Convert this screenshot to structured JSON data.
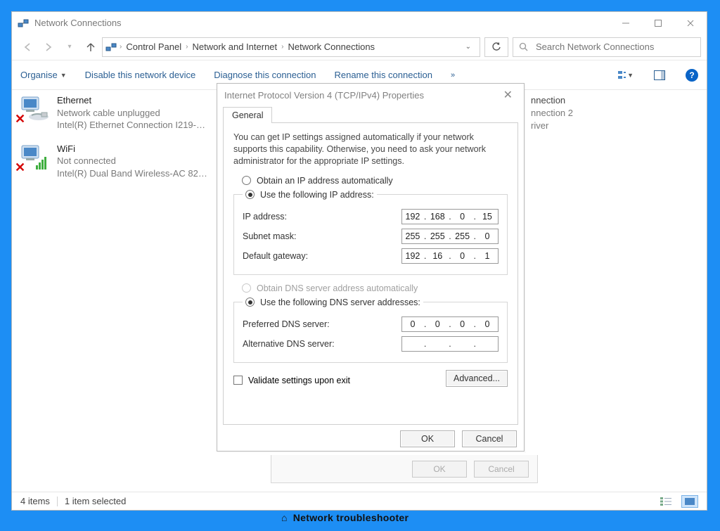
{
  "window": {
    "title": "Network Connections",
    "search_placeholder": "Search Network Connections"
  },
  "breadcrumb": [
    "Control Panel",
    "Network and Internet",
    "Network Connections"
  ],
  "cmdbar": {
    "organise": "Organise",
    "disable": "Disable this network device",
    "diagnose": "Diagnose this connection",
    "rename": "Rename this connection"
  },
  "connections": [
    {
      "name": "Ethernet",
      "status": "Network cable unplugged",
      "device": "Intel(R) Ethernet Connection I219-…",
      "error": true
    },
    {
      "name": "WiFi",
      "status": "Not connected",
      "device": "Intel(R) Dual Band Wireless-AC 82…",
      "error": true
    }
  ],
  "hidden_conn": {
    "l1": "nnection",
    "l2": "nnection 2",
    "l3": "river"
  },
  "statusbar": {
    "items": "4 items",
    "selected": "1 item selected"
  },
  "parent_dialog": {
    "ok": "OK",
    "cancel": "Cancel"
  },
  "dialog": {
    "title": "Internet Protocol Version 4 (TCP/IPv4) Properties",
    "tab": "General",
    "intro": "You can get IP settings assigned automatically if your network supports this capability. Otherwise, you need to ask your network administrator for the appropriate IP settings.",
    "radio_auto_ip": "Obtain an IP address automatically",
    "radio_static_ip": "Use the following IP address:",
    "radio_auto_dns": "Obtain DNS server address automatically",
    "radio_static_dns": "Use the following DNS server addresses:",
    "labels": {
      "ip": "IP address:",
      "mask": "Subnet mask:",
      "gw": "Default gateway:",
      "dns1": "Preferred DNS server:",
      "dns2": "Alternative DNS server:"
    },
    "values": {
      "ip": [
        "192",
        "168",
        "0",
        "15"
      ],
      "mask": [
        "255",
        "255",
        "255",
        "0"
      ],
      "gw": [
        "192",
        "16",
        "0",
        "1"
      ],
      "dns1": [
        "0",
        "0",
        "0",
        "0"
      ],
      "dns2": [
        "",
        "",
        "",
        ""
      ]
    },
    "validate": "Validate settings upon exit",
    "advanced": "Advanced...",
    "ok": "OK",
    "cancel": "Cancel"
  },
  "trouble_text": "Network troubleshooter"
}
